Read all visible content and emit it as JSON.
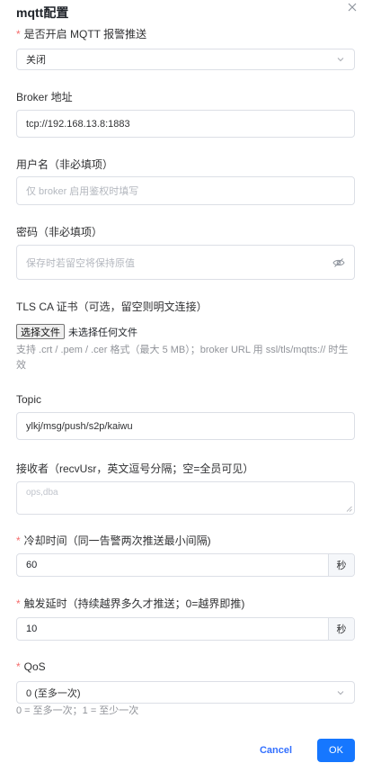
{
  "dialog": {
    "title": "mqtt配置"
  },
  "icons": {
    "close": "close-icon",
    "arrow": "chevron-down-icon",
    "eye": "eye-off-icon"
  },
  "colors": {
    "primary": "#1677ff",
    "required": "#f56c6c",
    "border": "#dcdfe6"
  },
  "enable": {
    "required_mark": "*",
    "label": "是否开启 MQTT 报警推送",
    "value": "关闭"
  },
  "broker": {
    "label": "Broker 地址",
    "value": "tcp://192.168.13.8:1883"
  },
  "username": {
    "label": "用户名（非必填项）",
    "placeholder": "仅 broker 启用鉴权时填写"
  },
  "password": {
    "label": "密码（非必填项）",
    "placeholder": "保存时若留空将保持原值"
  },
  "tls": {
    "label": "TLS CA 证书（可选，留空则明文连接）",
    "button": "选择文件",
    "file_status": "未选择任何文件",
    "hint_line1": "支持 .crt / .pem / .cer 格式（最大 5 MB）；broker URL 用 ssl/tls/mqtts:// 时生",
    "hint_line2": "效"
  },
  "topic": {
    "label": "Topic",
    "value": "ylkj/msg/push/s2p/kaiwu"
  },
  "receivers": {
    "label": "接收者（recvUsr，英文逗号分隔；空=全员可见）",
    "placeholder": "ops,dba"
  },
  "cooldown": {
    "required_mark": "*",
    "label": "冷却时间（同一告警两次推送最小间隔)",
    "value": "60",
    "unit": "秒"
  },
  "delay": {
    "required_mark": "*",
    "label": "触发延时（持续越界多久才推送；0=越界即推)",
    "value": "10",
    "unit": "秒"
  },
  "qos": {
    "required_mark": "*",
    "label": "QoS",
    "value": "0 (至多一次)",
    "hint": "0 = 至多一次；1 = 至少一次"
  },
  "footer": {
    "cancel": "Cancel",
    "ok": "OK"
  }
}
